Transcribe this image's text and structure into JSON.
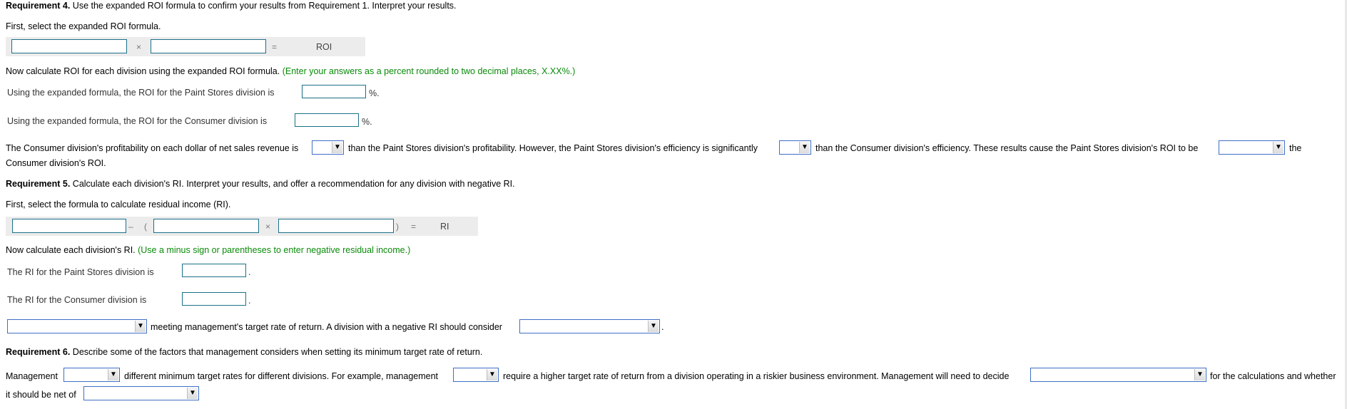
{
  "req4": {
    "heading_bold": "Requirement 4.",
    "heading_text": " Use the expanded ROI formula to confirm your results from Requirement 1. Interpret your results.",
    "select_formula_prompt": "First, select the expanded ROI formula.",
    "formula": {
      "operator_times": "×",
      "operator_equals": "=",
      "result_label": "ROI",
      "input1_value": "",
      "input2_value": ""
    },
    "calc_prompt": "Now calculate ROI for each division using the expanded ROI formula.",
    "calc_hint": " (Enter your answers as a percent rounded to two decimal places, X.XX%.)",
    "paint_label": "Using the expanded formula, the ROI for the Paint Stores division is",
    "paint_value": "",
    "paint_suffix": "%.",
    "consumer_label": "Using the expanded formula, the ROI for the Consumer division is",
    "consumer_value": "",
    "consumer_suffix": "%.",
    "interpret": {
      "part1": "The Consumer division's profitability on each dollar of net sales revenue is",
      "select1_value": "",
      "part2": "than the Paint Stores division's profitability. However, the Paint Stores division's efficiency is significantly",
      "select2_value": "",
      "part3": "than the Consumer division's efficiency. These results cause the Paint Stores division's ROI to be",
      "select3_value": "",
      "part4": "the",
      "part5": "Consumer division's ROI."
    }
  },
  "req5": {
    "heading_bold": "Requirement 5.",
    "heading_text": " Calculate each division's RI. Interpret your results, and offer a recommendation for any division with negative RI.",
    "select_formula_prompt": "First, select the formula to calculate residual income (RI).",
    "formula": {
      "operator_minus": "–",
      "open_paren": "(",
      "operator_times": "×",
      "close_paren": ")",
      "operator_equals": "=",
      "result_label": "RI",
      "input1_value": "",
      "input2_value": "",
      "input3_value": ""
    },
    "calc_prompt": "Now calculate each division's RI.",
    "calc_hint": " (Use a minus sign or parentheses to enter negative residual income.)",
    "paint_label": "The RI for the Paint Stores division is",
    "paint_value": "",
    "paint_suffix": ".",
    "consumer_label": "The RI for the Consumer division is",
    "consumer_value": "",
    "consumer_suffix": ".",
    "interpret": {
      "select1_value": "",
      "part1": "meeting management's target rate of return. A division with a negative RI should consider",
      "select2_value": "",
      "part2": "."
    }
  },
  "req6": {
    "heading_bold": "Requirement 6.",
    "heading_text": " Describe some of the factors that management considers when setting its minimum target rate of return.",
    "sentence": {
      "part1": "Management",
      "select1_value": "",
      "part2": "different minimum target rates for different divisions. For example, management",
      "select2_value": "",
      "part3": "require a higher target rate of return from a division operating in a riskier business environment. Management will need to decide",
      "select3_value": "",
      "part4": "for the calculations and whether",
      "part5": "it should be net of",
      "select4_value": ""
    }
  },
  "icons": {
    "dropdown_arrow": "▼"
  }
}
